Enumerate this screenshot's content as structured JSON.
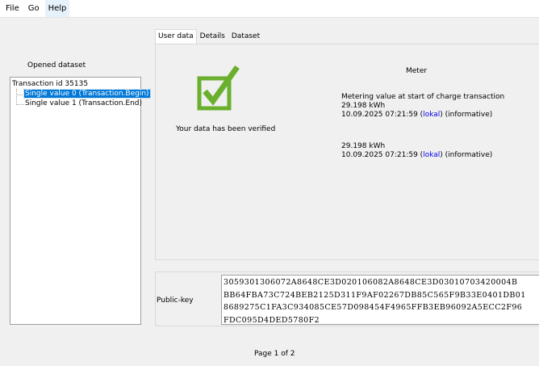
{
  "menu": {
    "items": [
      "File",
      "Go",
      "Help"
    ]
  },
  "left": {
    "title": "Opened dataset",
    "root": "Transaction id 35135",
    "children": [
      "Single value 0 (Transaction.Begin)",
      "Single value 1 (Transaction.End)"
    ]
  },
  "tabs": [
    "User data",
    "Details",
    "Dataset"
  ],
  "verification": {
    "icon": "checkmark-icon",
    "status_text": "Your data has been verified",
    "icon_color": "#6aaf2e"
  },
  "meter": {
    "title": "Meter",
    "start": {
      "caption": "Metering value at start of charge transaction",
      "value": "29.198 kWh",
      "timestamp": "10.09.2025 07:21:59",
      "tz_link": "lokal",
      "note": "(informative)"
    },
    "end": {
      "value": "29.198 kWh",
      "timestamp": "10.09.2025 07:21:59",
      "tz_link": "lokal",
      "note": "(informative)"
    }
  },
  "public_key": {
    "label": "Public-key",
    "lines": [
      "3059301306072A8648CE3D020106082A8648CE3D03010703420004B",
      "BB64FBA73C724BEB2125D311F9AF02267DB85C565F9B33E0401DB01",
      "8689275C1FA3C934085CE57D098454F4965FFB3EB96092A5ECC2F96",
      "FDC095D4DED5780F2"
    ]
  },
  "pager": {
    "text": "Page 1 of 2"
  }
}
